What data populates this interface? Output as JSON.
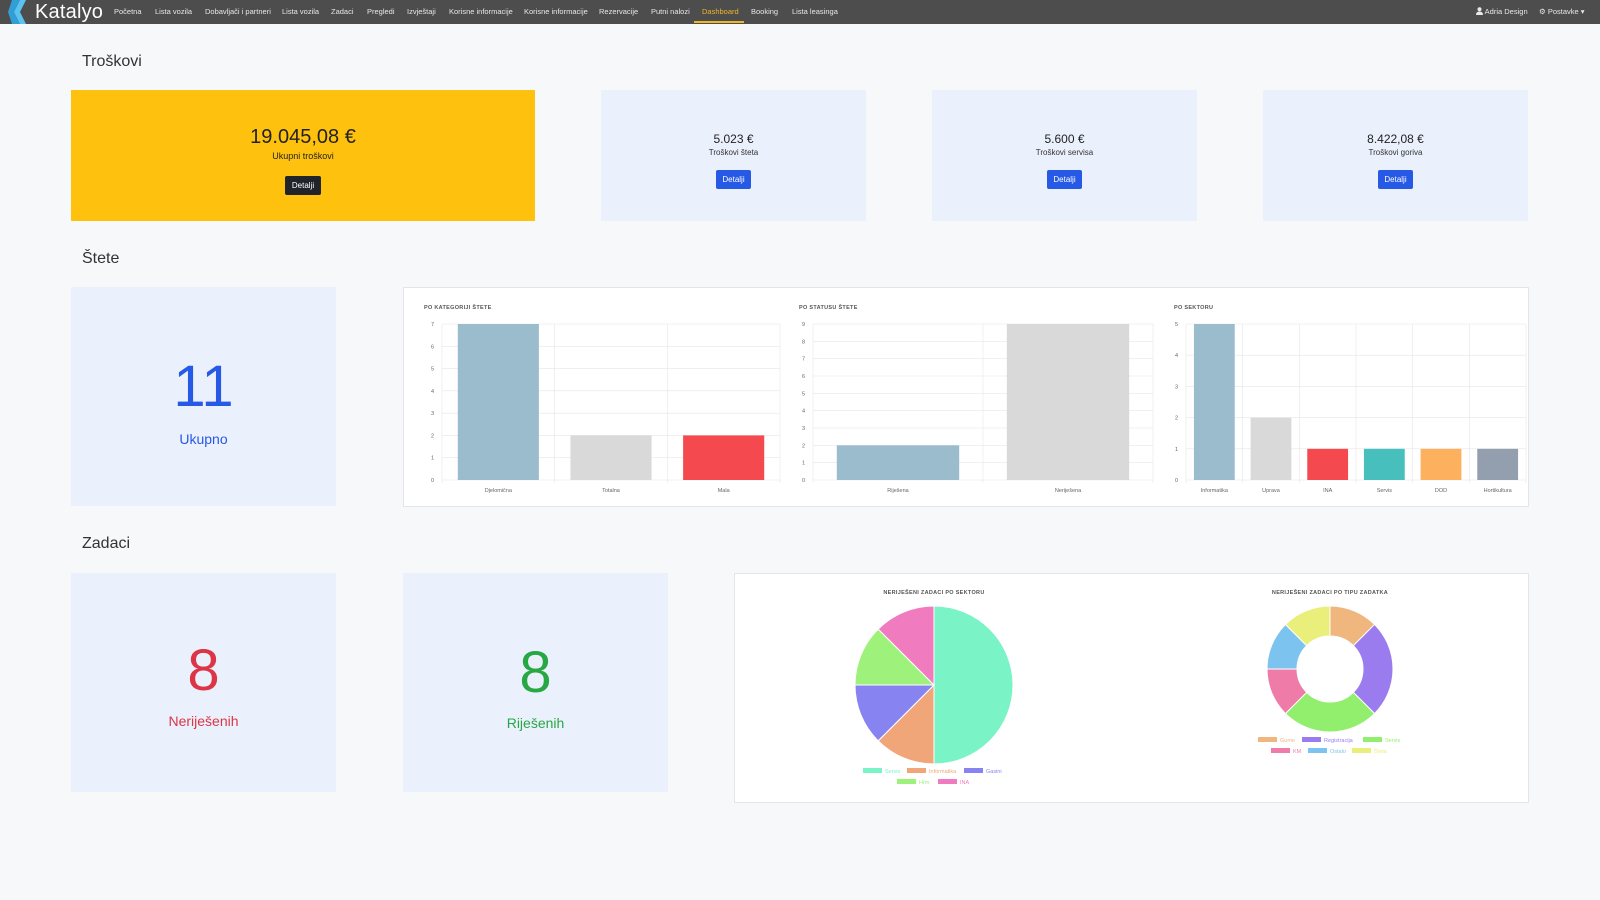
{
  "nav": {
    "brand": "Katalyo",
    "items": [
      "Početna",
      "Lista vozila",
      "Dobavljači i partneri",
      "Lista vozila",
      "Zadaci",
      "Pregledi",
      "Izvještaji",
      "Korisne informacije",
      "Korisne informacije",
      "Rezervacije",
      "Putni nalozi",
      "Dashboard",
      "Booking",
      "Lista leasinga"
    ],
    "active": "Dashboard",
    "user": "Adria Design",
    "settings": "Postavke"
  },
  "costs": {
    "title": "Troškovi",
    "total": {
      "value": "19.045,08 €",
      "label": "Ukupni troškovi",
      "button": "Detalji"
    },
    "items": [
      {
        "value": "5.023 €",
        "label": "Troškovi šteta",
        "button": "Detalji"
      },
      {
        "value": "5.600 €",
        "label": "Troškovi servisa",
        "button": "Detalji"
      },
      {
        "value": "8.422,08 €",
        "label": "Troškovi goriva",
        "button": "Detalji"
      }
    ]
  },
  "damages": {
    "title": "Štete",
    "total": {
      "value": "11",
      "label": "Ukupno"
    }
  },
  "tasks": {
    "title": "Zadaci",
    "unresolved": {
      "value": "8",
      "label": "Neriješenih"
    },
    "resolved": {
      "value": "8",
      "label": "Riješenih"
    }
  },
  "colors": {
    "yellow": "#fec10e",
    "blue": "#2659e6",
    "red": "#dc3545",
    "green": "#28a745",
    "navbar": "#4d4d4d"
  },
  "chart_data": [
    {
      "type": "bar",
      "title": "PO KATEGORIJI ŠTETE",
      "categories": [
        "Djelomična",
        "Totalna",
        "Mala"
      ],
      "values": [
        7,
        2,
        2
      ],
      "colors": [
        "#9bbccc",
        "#d9d9d9",
        "#f44a4f"
      ],
      "ylim": [
        0,
        7
      ],
      "yticks": [
        0,
        1,
        2,
        3,
        4,
        5,
        6,
        7
      ]
    },
    {
      "type": "bar",
      "title": "PO STATUSU ŠTETE",
      "categories": [
        "Riješena",
        "Neriješena"
      ],
      "values": [
        2,
        9
      ],
      "colors": [
        "#9bbccc",
        "#d9d9d9"
      ],
      "ylim": [
        0,
        9
      ],
      "yticks": [
        0,
        1,
        2,
        3,
        4,
        5,
        6,
        7,
        8,
        9
      ]
    },
    {
      "type": "bar",
      "title": "PO SEKTORU",
      "categories": [
        "Informatika",
        "Uprava",
        "INA",
        "Servis",
        "DOD",
        "Hortikultura"
      ],
      "values": [
        5,
        2,
        1,
        1,
        1,
        1
      ],
      "colors": [
        "#9bbccc",
        "#d9d9d9",
        "#f44a4f",
        "#47bfbd",
        "#fdb05e",
        "#939eae"
      ],
      "ylim": [
        0,
        5
      ],
      "yticks": [
        0,
        1,
        2,
        3,
        4,
        5
      ]
    },
    {
      "type": "pie",
      "title": "NERIJEŠENI ZADACI PO SEKTORU",
      "labels": [
        "Servis",
        "Informatika",
        "Gasini",
        "Hrm",
        "INA"
      ],
      "values": [
        4,
        1,
        1,
        1,
        1
      ],
      "colors": [
        "#7af3c6",
        "#f1a67a",
        "#8783f0",
        "#9ef17b",
        "#f17bbf"
      ]
    },
    {
      "type": "pie",
      "title": "NERIJEŠENI ZADACI PO TIPU ZADATKA",
      "donut": true,
      "labels": [
        "Gume",
        "Registracija",
        "Servis",
        "KM",
        "Ostalo",
        "Šteta"
      ],
      "values": [
        1,
        2,
        2,
        1,
        1,
        1
      ],
      "colors": [
        "#efb67e",
        "#9b7cef",
        "#92ef6d",
        "#ef7ca8",
        "#7cc4ef",
        "#eaef7c"
      ]
    }
  ]
}
